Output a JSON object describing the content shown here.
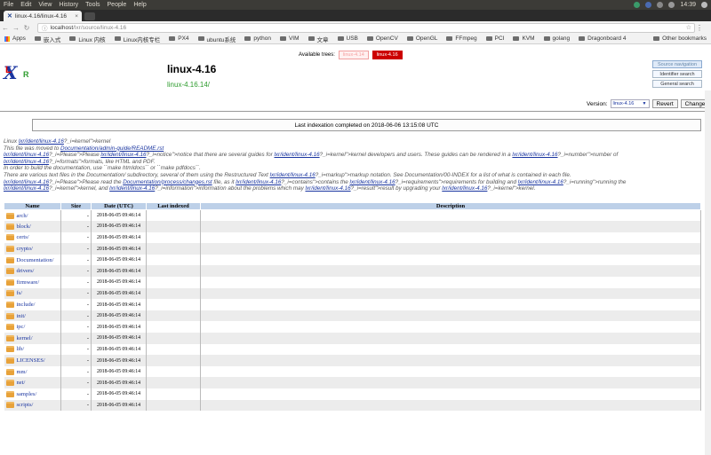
{
  "os_bar": {
    "menus": [
      "File",
      "Edit",
      "View",
      "History",
      "Tools",
      "People",
      "Help"
    ],
    "clock": "14:39"
  },
  "browser": {
    "tab_title": "linux-4.16/linux-4.16",
    "url_host": "localhost",
    "url_path": "/lxr/source/linux-4.16",
    "bookmarks": [
      "Apps",
      "嵌入式",
      "Linux 内核",
      "Linux内核专栏",
      "PX4",
      "ubuntu系统",
      "python",
      "VIM",
      "文章",
      "USB",
      "OpenCV",
      "OpenGL",
      "FFmpeg",
      "PCI",
      "KVM",
      "golang",
      "Dragonboard 4"
    ],
    "other_bookmarks": "Other bookmarks"
  },
  "header": {
    "available_trees_label": "Available trees:",
    "trees": [
      "linux-4.14",
      "linux-4.16"
    ],
    "title": "linux-4.16",
    "version_link": "linux-4.16.14/",
    "side_buttons": [
      "Source navigation",
      "Identifier search",
      "General search"
    ],
    "version_label": "Version:",
    "version_value": "linux-4.16",
    "revert_label": "Revert",
    "change_label": "Change"
  },
  "index_status": "Last indexation completed on 2018-06-06 13:15:08 UTC",
  "readme": {
    "l1a": "Linux ",
    "l1b": "lxr/ident/linux-4.16",
    "l1c": "?_i=kernel\">kernel",
    "l2a": "This file was moved to ",
    "l2b": "Documentation/admin-guide/README.rst",
    "l3a": "lxr/ident/linux-4.16",
    "l3b": "?_i=Please\">Please ",
    "l3c": "lxr/ident/linux-4.16",
    "l3d": "?_i=notice\">notice that there are several guides for ",
    "l3e": "lxr/ident/linux-4.16",
    "l3f": "?_i=kernel\">kernel developers and users. These guides can be rendered in a ",
    "l3g": "lxr/ident/linux-4.16",
    "l3h": "?_i=number\">number of",
    "l4a": "lxr/ident/linux-4.16",
    "l4b": "?_i=formats\">formats, like HTML and PDF.",
    "l5": "In order to build the documentation, use ``make htmldocs`` or ``make pdfdocs``.",
    "l6a": "There are various text files in the Documentation/ subdirectory, several of them using the Restructured Text ",
    "l6b": "lxr/ident/linux-4.16",
    "l6c": "?_i=markup\">markup notation. See Documentation/00-INDEX for a list of what is contained in each file.",
    "l7a": "lxr/ident/linux-4.16",
    "l7b": "?_i=Please\">Please read the ",
    "l7c": "Documentation/process/changes.rst",
    "l7d": " file, as it ",
    "l7e": "lxr/ident/linux-4.16",
    "l7f": "?_i=contains\">contains the ",
    "l7g": "lxr/ident/linux-4.16",
    "l7h": "?_i=requirements\">requirements for building and ",
    "l7i": "lxr/ident/linux-4.16",
    "l7j": "?_i=running\">running the",
    "l8a": "lxr/ident/linux-4.16",
    "l8b": "?_i=kernel\">kernel, and ",
    "l8c": "lxr/ident/linux-4.16",
    "l8d": "?_i=information\">information about the problems which may ",
    "l8e": "lxr/ident/linux-4.16",
    "l8f": "?_i=result\">result by upgrading your ",
    "l8g": "lxr/ident/linux-4.16",
    "l8h": "?_i=kernel\">kernel."
  },
  "table": {
    "headers": [
      "Name",
      "Size",
      "Date (UTC)",
      "Last indexed",
      "Description"
    ],
    "rows": [
      {
        "name": "arch/",
        "size": "-",
        "date": "2018-06-05 09:46:14"
      },
      {
        "name": "block/",
        "size": "-",
        "date": "2018-06-05 09:46:14"
      },
      {
        "name": "certs/",
        "size": "-",
        "date": "2018-06-05 09:46:14"
      },
      {
        "name": "crypto/",
        "size": "-",
        "date": "2018-06-05 09:46:14"
      },
      {
        "name": "Documentation/",
        "size": "-",
        "date": "2018-06-05 09:46:14"
      },
      {
        "name": "drivers/",
        "size": "-",
        "date": "2018-06-05 09:46:14"
      },
      {
        "name": "firmware/",
        "size": "-",
        "date": "2018-06-05 09:46:14"
      },
      {
        "name": "fs/",
        "size": "-",
        "date": "2018-06-05 09:46:14"
      },
      {
        "name": "include/",
        "size": "-",
        "date": "2018-06-05 09:46:14"
      },
      {
        "name": "init/",
        "size": "-",
        "date": "2018-06-05 09:46:14"
      },
      {
        "name": "ipc/",
        "size": "-",
        "date": "2018-06-05 09:46:14"
      },
      {
        "name": "kernel/",
        "size": "-",
        "date": "2018-06-05 09:46:14"
      },
      {
        "name": "lib/",
        "size": "-",
        "date": "2018-06-05 09:46:14"
      },
      {
        "name": "LICENSES/",
        "size": "-",
        "date": "2018-06-05 09:46:14"
      },
      {
        "name": "mm/",
        "size": "-",
        "date": "2018-06-05 09:46:14"
      },
      {
        "name": "net/",
        "size": "-",
        "date": "2018-06-05 09:46:14"
      },
      {
        "name": "samples/",
        "size": "-",
        "date": "2018-06-05 09:46:14"
      },
      {
        "name": "scripts/",
        "size": "-",
        "date": "2018-06-05 09:46:14"
      }
    ]
  }
}
